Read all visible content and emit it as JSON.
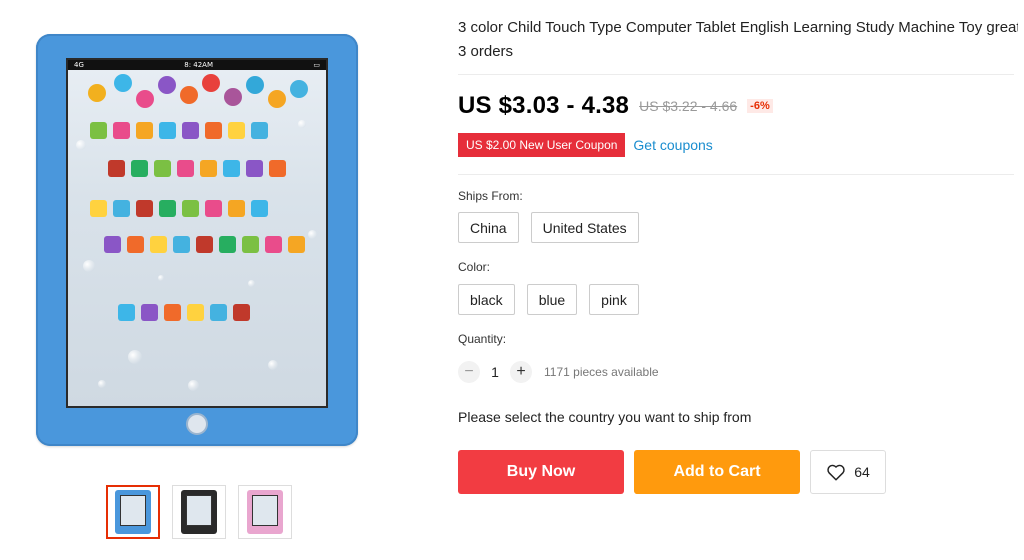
{
  "product": {
    "title": "3 color Child Touch Type Computer Tablet English Learning Study Machine Toy great",
    "orders": "3 orders",
    "price": "US $3.03 - 4.38",
    "old_price": "US $3.22 - 4.66",
    "discount": "-6%",
    "coupon": "US $2.00 New User Coupon",
    "get_coupons": "Get coupons"
  },
  "tablet_screen": {
    "status_left": "4G",
    "status_time": "8: 42AM"
  },
  "ships_from": {
    "label": "Ships From:",
    "options": [
      "China",
      "United States"
    ]
  },
  "color": {
    "label": "Color:",
    "options": [
      "black",
      "blue",
      "pink"
    ]
  },
  "quantity": {
    "label": "Quantity:",
    "minus": "−",
    "value": "1",
    "plus": "+",
    "available": "1171 pieces available"
  },
  "ship_message": "Please select the country you want to ship from",
  "buttons": {
    "buy_now": "Buy Now",
    "add_to_cart": "Add to Cart",
    "wishlist_count": "64"
  },
  "colors": {
    "accent_red": "#f23c42",
    "accent_orange": "#ff9a0d",
    "link_blue": "#1a8dcf",
    "tablet_blue": "#4a97dc"
  },
  "thumbnails": [
    {
      "variant": "blue",
      "color": "#4a97dc"
    },
    {
      "variant": "black",
      "color": "#2a2a2a"
    },
    {
      "variant": "pink",
      "color": "#e9a6cf"
    }
  ]
}
